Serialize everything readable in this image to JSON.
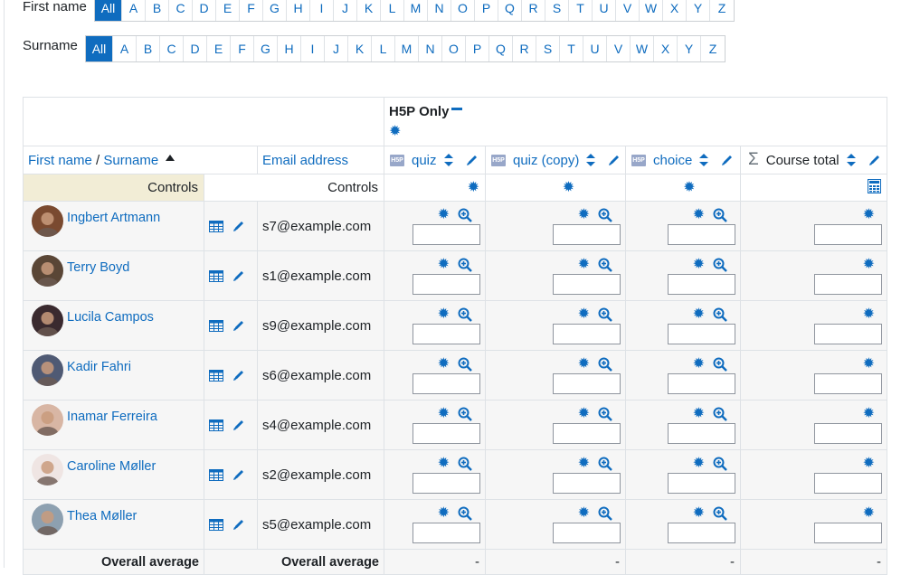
{
  "firstname_filter": {
    "label": "First name",
    "letters": [
      "All",
      "A",
      "B",
      "C",
      "D",
      "E",
      "F",
      "G",
      "H",
      "I",
      "J",
      "K",
      "L",
      "M",
      "N",
      "O",
      "P",
      "Q",
      "R",
      "S",
      "T",
      "U",
      "V",
      "W",
      "X",
      "Y",
      "Z"
    ],
    "active": "All"
  },
  "surname_filter": {
    "label": "Surname",
    "letters": [
      "All",
      "A",
      "B",
      "C",
      "D",
      "E",
      "F",
      "G",
      "H",
      "I",
      "J",
      "K",
      "L",
      "M",
      "N",
      "O",
      "P",
      "Q",
      "R",
      "S",
      "T",
      "U",
      "V",
      "W",
      "X",
      "Y",
      "Z"
    ],
    "active": "All"
  },
  "category": {
    "title": "H5P Only"
  },
  "columns": {
    "firstname": "First name",
    "separator": "/",
    "surname": "Surname",
    "email": "Email address",
    "items": [
      {
        "name": "quiz",
        "icon": "h5p-icon"
      },
      {
        "name": "quiz (copy)",
        "icon": "h5p-icon"
      },
      {
        "name": "choice",
        "icon": "h5p-icon"
      }
    ],
    "total": "Course total"
  },
  "controls_label": "Controls",
  "users": [
    {
      "name": "Ingbert Artmann",
      "email": "s7@example.com",
      "avatar_color": "#7a4a30"
    },
    {
      "name": "Terry Boyd",
      "email": "s1@example.com",
      "avatar_color": "#5a4636"
    },
    {
      "name": "Lucila Campos",
      "email": "s9@example.com",
      "avatar_color": "#3a2a2f"
    },
    {
      "name": "Kadir Fahri",
      "email": "s6@example.com",
      "avatar_color": "#4f5a74"
    },
    {
      "name": "Inamar Ferreira",
      "email": "s4@example.com",
      "avatar_color": "#d8b6a4"
    },
    {
      "name": "Caroline Møller",
      "email": "s2@example.com",
      "avatar_color": "#efe5e3"
    },
    {
      "name": "Thea Møller",
      "email": "s5@example.com",
      "avatar_color": "#8da0b0"
    }
  ],
  "overall_average": {
    "label": "Overall average",
    "values": [
      "-",
      "-",
      "-",
      "-"
    ]
  },
  "colors": {
    "link": "#0f6cbf",
    "controls_bg": "#f2edd6"
  }
}
